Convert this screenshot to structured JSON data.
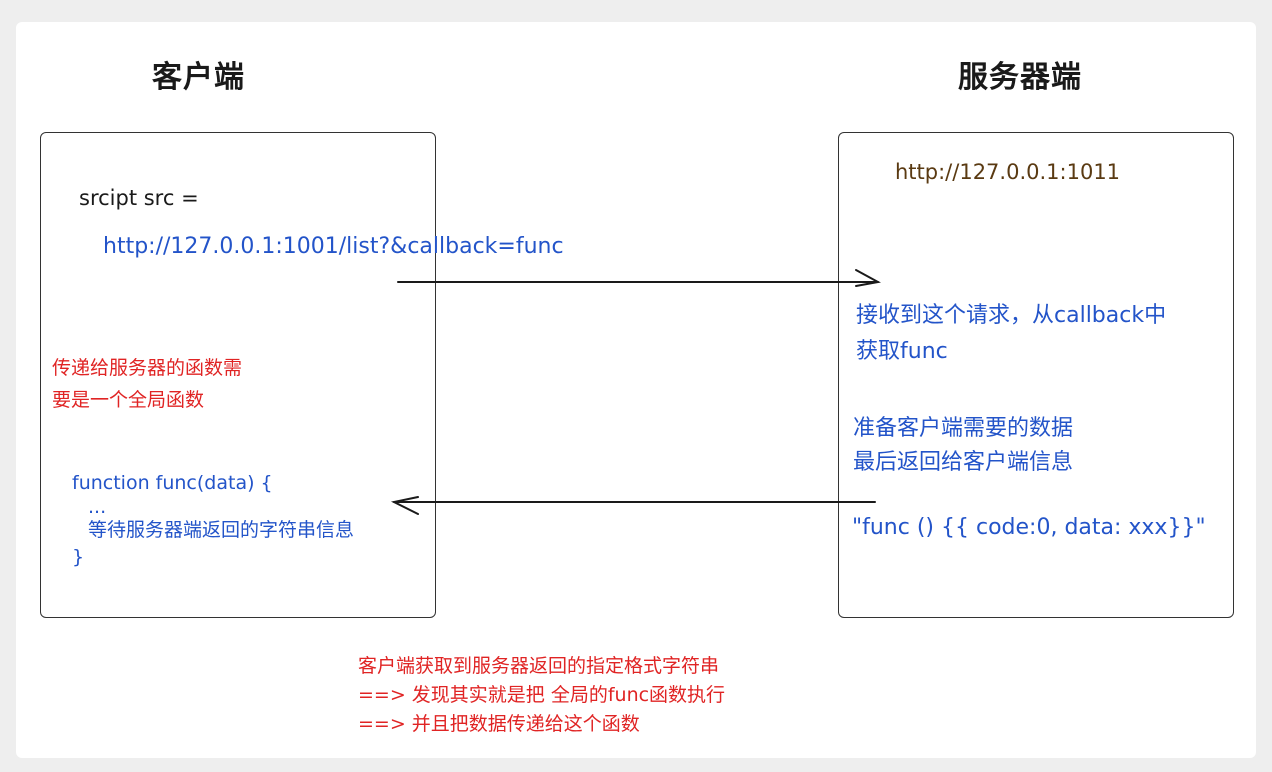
{
  "headings": {
    "client": "客户端",
    "server": "服务器端"
  },
  "client_box": {
    "script_label": "srcipt src =",
    "request_url": "http://127.0.0.1:1001/list?&callback=func",
    "note_line1": "传递给服务器的函数需",
    "note_line2": "要是一个全局函数",
    "code_line1": "function func(data) {",
    "code_line2": "...",
    "code_line3": "等待服务器端返回的字符串信息",
    "code_line4": "}"
  },
  "server_box": {
    "address": "http://127.0.0.1:1011",
    "step1_line1": "接收到这个请求，从callback中",
    "step1_line2": "获取func",
    "step2_line1": "准备客户端需要的数据",
    "step2_line2": "最后返回给客户端信息",
    "response": "\"func () {{ code:0, data: xxx}}\""
  },
  "footer": {
    "line1": "客户端获取到服务器返回的指定格式字符串",
    "line2": "==> 发现其实就是把 全局的func函数执行",
    "line3": "==> 并且把数据传递给这个函数"
  },
  "colors": {
    "heading": "#1a1a1a",
    "code_blue": "#2354c9",
    "note_red": "#e02424",
    "address_brown": "#5a3a12",
    "line": "#1a1a1a"
  }
}
